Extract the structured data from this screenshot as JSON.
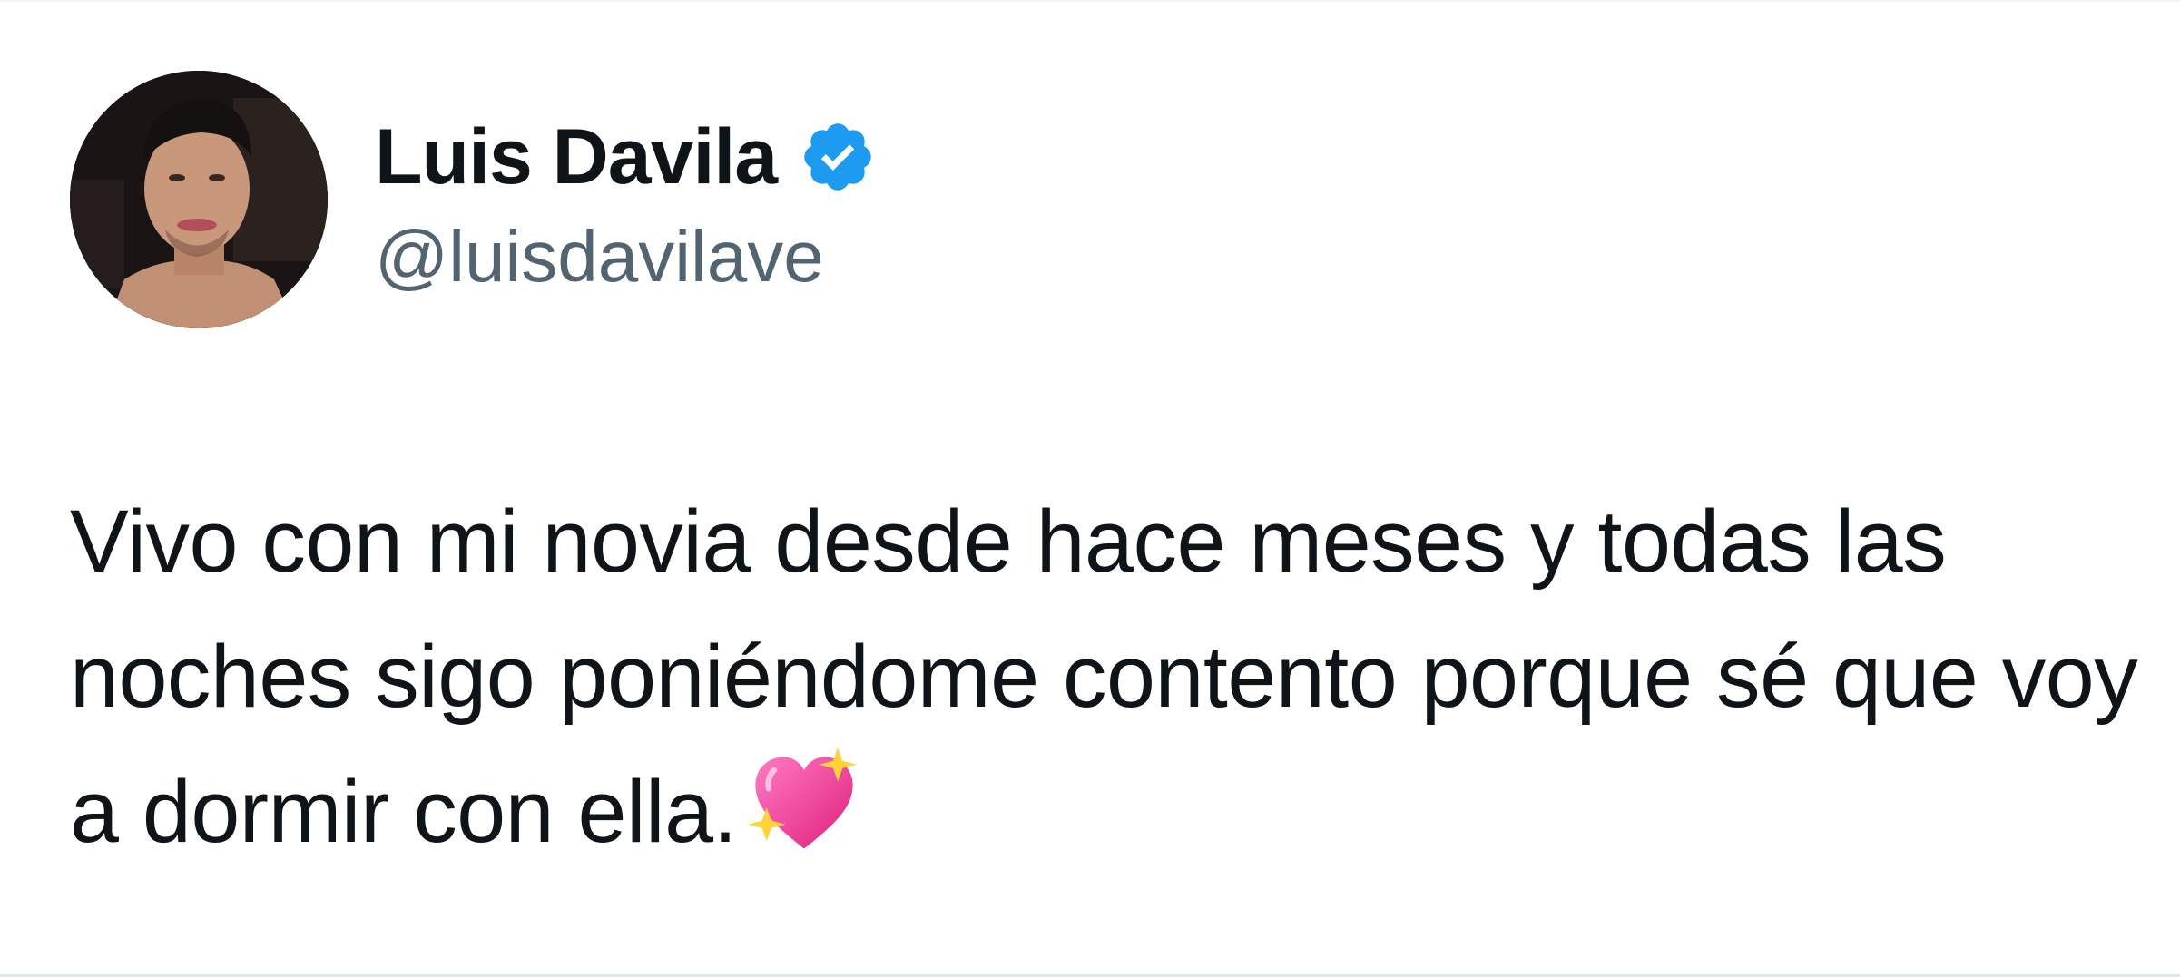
{
  "tweet": {
    "author": {
      "display_name": "Luis Davila",
      "handle": "@luisdavilave",
      "verified": true,
      "avatar_icon": "profile-photo"
    },
    "text": "Vivo con mi novia desde hace meses y todas las noches sigo poniéndome contento porque sé que voy a dormir con ella.",
    "emoji": "sparkling-heart-icon"
  },
  "colors": {
    "text_primary": "#0f1419",
    "text_secondary": "#536471",
    "verified_blue": "#1d9bf0",
    "emoji_pink": "#f04aa0"
  }
}
